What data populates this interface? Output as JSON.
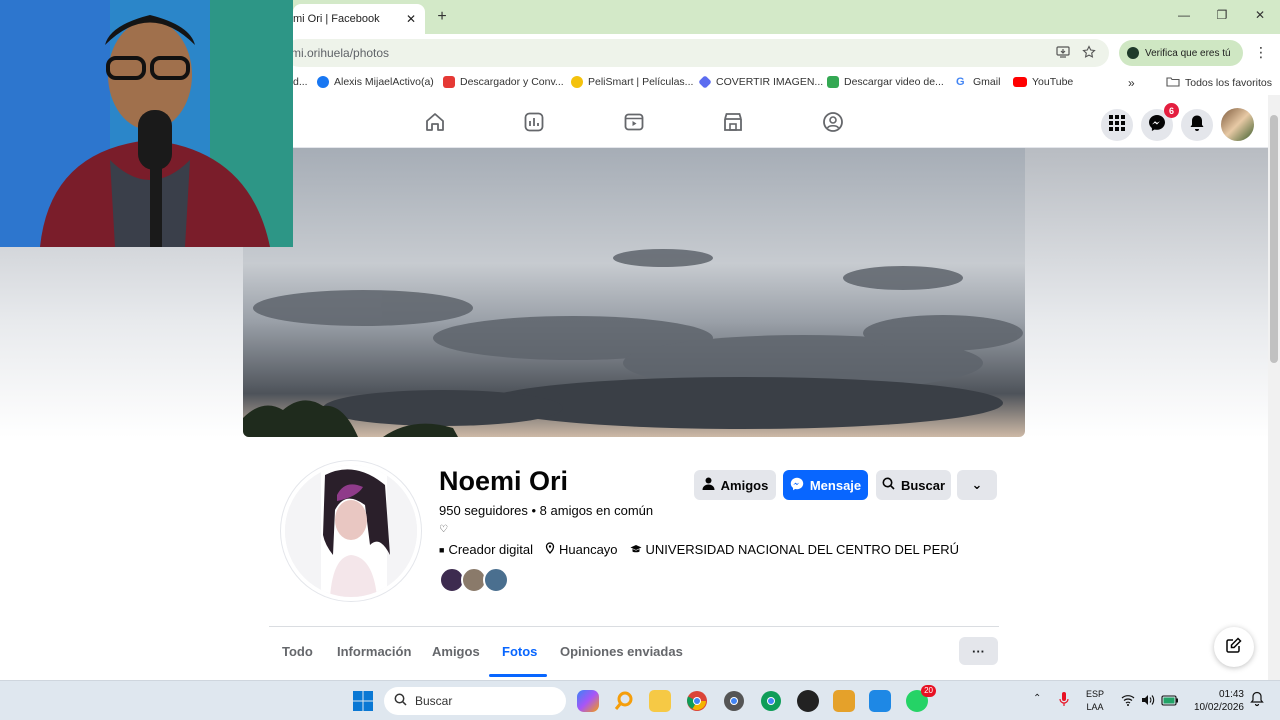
{
  "browser": {
    "tab_title": "mi Ori | Facebook",
    "tab_close": "✕",
    "new_tab": "+",
    "window_controls": {
      "minimize": "—",
      "maximize": "❐",
      "close": "✕"
    },
    "url": "mi.orihuela/photos",
    "verify_label": "Verifica que eres tú",
    "menu": "⋮",
    "bookmarks": [
      {
        "label": "d...",
        "icon_color": "#888888"
      },
      {
        "label": "Alexis MijaelActivo(a)",
        "icon_color": "#1877f2"
      },
      {
        "label": "Descargador y Conv...",
        "icon_color": "#e53935"
      },
      {
        "label": "PeliSmart | Películas...",
        "icon_color": "#f4c20d"
      },
      {
        "label": "COVERTIR IMAGEN...",
        "icon_color": "#5b6cf0"
      },
      {
        "label": "Descargar video de...",
        "icon_color": "#34a853"
      },
      {
        "label": "Gmail",
        "icon_color": "#ea4335"
      },
      {
        "label": "YouTube",
        "icon_color": "#ff0000"
      }
    ],
    "bookmarks_more": "»",
    "all_bookmarks": "Todos los favoritos"
  },
  "facebook": {
    "nav_icons": [
      "home-icon",
      "feeds-icon",
      "video-icon",
      "marketplace-icon",
      "groups-icon"
    ],
    "messenger_badge": "6",
    "profile": {
      "name": "Noemi Ori",
      "stats": "950 seguidores • 8 amigos en común",
      "heart": "♡",
      "info": [
        {
          "icon": "■",
          "text": "Creador digital"
        },
        {
          "icon": "⚲",
          "text": "Huancayo"
        },
        {
          "icon": "🎓",
          "text": "UNIVERSIDAD NACIONAL DEL CENTRO DEL PERÚ"
        }
      ],
      "mutual_colors": [
        "#3d2b4f",
        "#8a7a6a",
        "#4a6f8f"
      ]
    },
    "actions": {
      "friends": "Amigos",
      "message": "Mensaje",
      "search": "Buscar",
      "dropdown": "⌄"
    },
    "tabs": [
      "Todo",
      "Información",
      "Amigos",
      "Fotos",
      "Opiniones enviadas"
    ],
    "tabs_more": "···",
    "active_tab": "Fotos"
  },
  "taskbar": {
    "search_placeholder": "Buscar",
    "whatsapp_badge": "20",
    "language": "ESP",
    "layout": "LAA",
    "time": "01:43",
    "date": "10/02/2026"
  }
}
